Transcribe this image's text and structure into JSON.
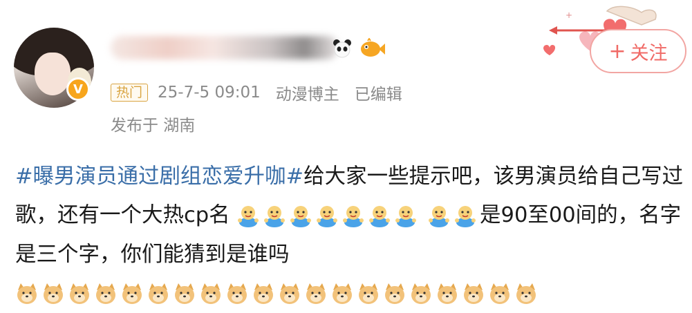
{
  "post": {
    "hot_label": "热门",
    "timestamp": "25-7-5 09:01",
    "category": "动漫博主",
    "edited": "已编辑",
    "location": "发布于 湖南",
    "follow_label": "关注",
    "follow_plus": "+",
    "verified_mark": "V",
    "hashtag": "#曝男演员通过剧组恋爱升咖#",
    "text_part1": "给大家一些提示吧，该男演员给自己写过歌，还有一个大热cp名",
    "text_part2": "是90至00间的，名字是三个字，你们能猜到是谁吗",
    "emoji_wx_count_line1": 7,
    "emoji_wx_count_line2": 2,
    "emoji_dog_count": 20
  },
  "icons": [
    "avatar",
    "verified-icon",
    "panda-icon",
    "fish-icon",
    "heart-arrow-icon",
    "wechat-emoji-icon",
    "doge-emoji-icon"
  ],
  "colors": {
    "hashtag": "#3a6ea8",
    "hot_badge": "#d9a441",
    "follow": "#f06a66",
    "meta": "#8a8a8a",
    "verified": "#f7a51c"
  }
}
